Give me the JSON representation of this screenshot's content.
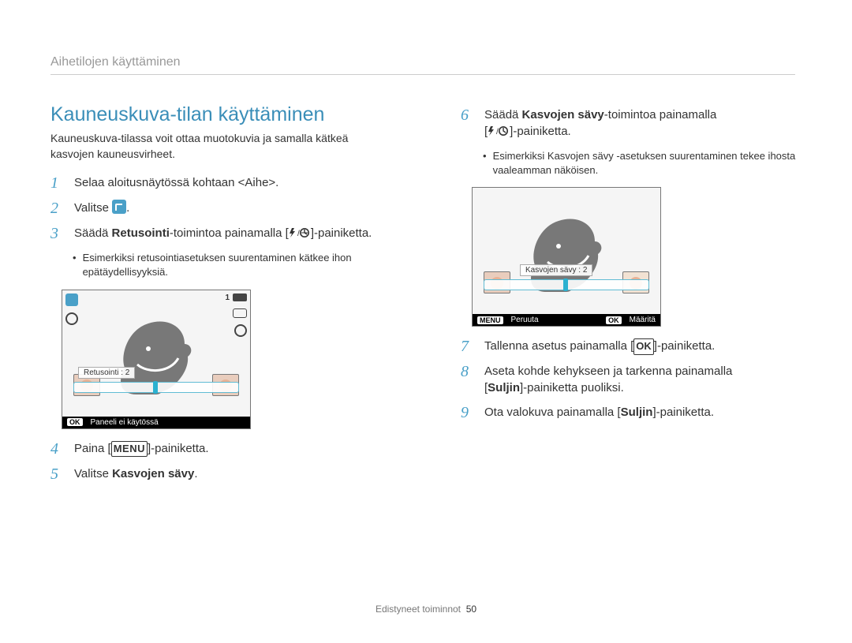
{
  "chapter": "Aihetilojen käyttäminen",
  "section_title": "Kauneuskuva-tilan käyttäminen",
  "intro": "Kauneuskuva-tilassa voit ottaa muotokuvia ja samalla kätkeä kasvojen kauneusvirheet.",
  "steps_left": {
    "1": "Selaa aloitusnäytössä kohtaan <Aihe>.",
    "2_pre": "Valitse ",
    "2_post": ".",
    "3_pre": "Säädä ",
    "3_bold": "Retusointi",
    "3_mid": "-toimintoa painamalla [",
    "3_post": "]-painiketta.",
    "3_bullet": "Esimerkiksi retusointiasetuksen suurentaminen kätkee ihon epätäydellisyyksiä.",
    "4_pre": "Paina [",
    "4_post": "]-painiketta.",
    "5_pre": "Valitse ",
    "5_bold": "Kasvojen sävy",
    "5_post": "."
  },
  "steps_right": {
    "6_pre": "Säädä ",
    "6_bold": "Kasvojen sävy",
    "6_mid": "-toimintoa painamalla",
    "6_line2_pre": "[",
    "6_line2_post": "]-painiketta.",
    "6_bullet": "Esimerkiksi Kasvojen sävy -asetuksen suurentaminen tekee ihosta vaaleamman näköisen.",
    "7_pre": "Tallenna asetus painamalla [",
    "7_post": "]-painiketta.",
    "8_pre": "Aseta kohde kehykseen ja tarkenna painamalla ",
    "8_line2_pre": "[",
    "8_bold": "Suljin",
    "8_line2_post": "]-painiketta puoliksi.",
    "9_pre": "Ota valokuva painamalla [",
    "9_bold": "Suljin",
    "9_post": "]-painiketta."
  },
  "screens": {
    "left": {
      "slider_label": "Retusointi : 2",
      "footer_chip": "OK",
      "footer_text": "Paneeli ei käytössä"
    },
    "right": {
      "slider_label": "Kasvojen sävy : 2",
      "menu_chip": "MENU",
      "menu_text": "Peruuta",
      "ok_chip": "OK",
      "ok_text": "Määritä"
    }
  },
  "buttons": {
    "ok": "OK",
    "menu": "MENU"
  },
  "footer": {
    "section": "Edistyneet toiminnot",
    "page": "50"
  }
}
